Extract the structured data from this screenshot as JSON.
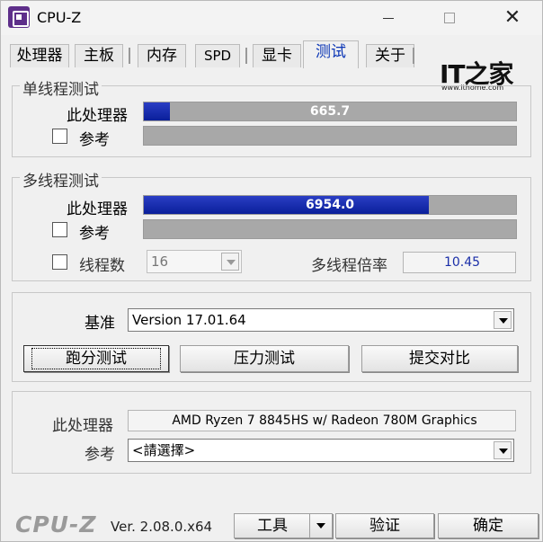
{
  "window": {
    "title": "CPU-Z"
  },
  "tabs": [
    {
      "label": "处理器"
    },
    {
      "label": "主板"
    },
    {
      "label": "内存"
    },
    {
      "label": "SPD"
    },
    {
      "label": "显卡"
    },
    {
      "label": "测试",
      "active": true
    },
    {
      "label": "关于"
    }
  ],
  "single_thread": {
    "title": "单线程测试",
    "this_cpu_label": "此处理器",
    "this_cpu_score": "665.7",
    "this_cpu_fraction": 0.07,
    "reference_label": "参考"
  },
  "multi_thread": {
    "title": "多线程测试",
    "this_cpu_label": "此处理器",
    "this_cpu_score": "6954.0",
    "this_cpu_fraction": 0.766,
    "reference_label": "参考",
    "threads_label": "线程数",
    "threads_value": "16",
    "ratio_label": "多线程倍率",
    "ratio_value": "10.45"
  },
  "benchmark": {
    "label": "基准",
    "version_value": "Version 17.01.64",
    "bench_button": "跑分测试",
    "stress_button": "压力测试",
    "submit_button": "提交对比"
  },
  "cpu_info": {
    "this_cpu_label": "此处理器",
    "this_cpu_name": "AMD Ryzen 7 8845HS w/ Radeon 780M Graphics",
    "reference_label": "参考",
    "reference_value": "<請選擇>"
  },
  "footer": {
    "logo": "CPU-Z",
    "version": "Ver. 2.08.0.x64",
    "tools_button": "工具",
    "validate_button": "验证",
    "ok_button": "确定"
  },
  "watermark": {
    "logo": "IT之家",
    "url": "www.ithome.com"
  },
  "colors": {
    "bar_fill": "#0a1f9a",
    "active_tab": "#0a35b5",
    "value_text": "#1b2fa8"
  }
}
